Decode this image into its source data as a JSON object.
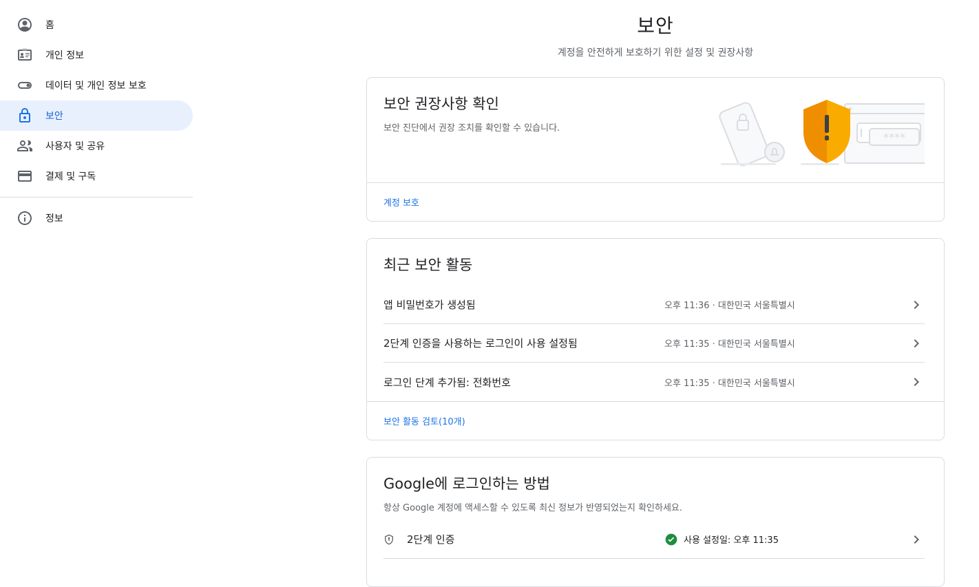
{
  "sidebar": {
    "items": [
      {
        "label": "홈",
        "icon": "account-circle-icon"
      },
      {
        "label": "개인 정보",
        "icon": "id-card-icon"
      },
      {
        "label": "데이터 및 개인 정보 보호",
        "icon": "toggle-icon"
      },
      {
        "label": "보안",
        "icon": "lock-icon",
        "active": true
      },
      {
        "label": "사용자 및 공유",
        "icon": "people-icon"
      },
      {
        "label": "결제 및 구독",
        "icon": "credit-card-icon"
      }
    ],
    "info": {
      "label": "정보",
      "icon": "info-icon"
    }
  },
  "header": {
    "title": "보안",
    "subtitle": "계정을 안전하게 보호하기 위한 설정 및 권장사항"
  },
  "recommendations": {
    "title": "보안 권장사항 확인",
    "description": "보안 진단에서 권장 조치를 확인할 수 있습니다.",
    "link": "계정 보호",
    "password_mask": "****"
  },
  "recent_activity": {
    "title": "최근 보안 활동",
    "items": [
      {
        "label": "앱 비밀번호가 생성됨",
        "meta": "오후 11:36 · 대한민국 서울특별시"
      },
      {
        "label": "2단계 인증을 사용하는 로그인이 사용 설정됨",
        "meta": "오후 11:35 · 대한민국 서울특별시"
      },
      {
        "label": "로그인 단계 추가됨: 전화번호",
        "meta": "오후 11:35 · 대한민국 서울특별시"
      }
    ],
    "link": "보안 활동 검토(10개)"
  },
  "signin": {
    "title": "Google에 로그인하는 방법",
    "description": "항상 Google 계정에 액세스할 수 있도록 최신 정보가 반영되었는지 확인하세요.",
    "items": [
      {
        "label": "2단계 인증",
        "status": "사용 설정일: 오후 11:35"
      }
    ]
  },
  "colors": {
    "accent": "#1a73e8",
    "active_bg": "#e8f0fe",
    "shield": "#f9ab00",
    "success": "#1e8e3e"
  }
}
